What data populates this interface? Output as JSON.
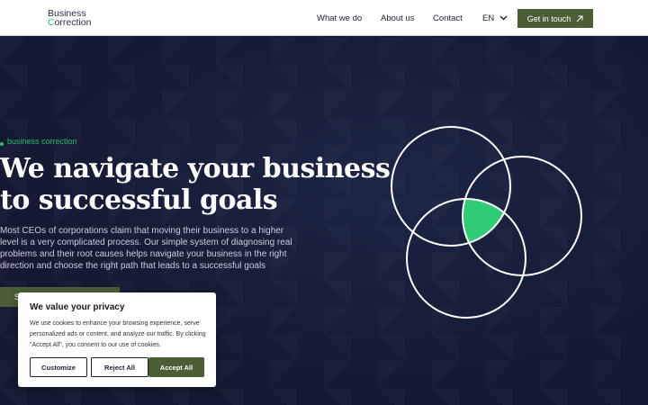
{
  "header": {
    "logo_line1": "Business",
    "logo_line2_rest": "orrection",
    "logo_line2_accent": "C",
    "nav": [
      "What we do",
      "About us",
      "Contact"
    ],
    "language": "EN",
    "cta_label": "Get in touch"
  },
  "hero": {
    "eyebrow": "business correction",
    "title_line1": "We navigate your business",
    "title_line2": "to successful goals",
    "description": "Most CEOs of corporations claim that moving their business to a higher level is a very complicated process. Our simple system of diagnosing real problems and their root causes helps navigate your business in the right direction and choose the right path that leads to a successful goals",
    "button_label": "S"
  },
  "cookie": {
    "title": "We value your privacy",
    "text": "We use cookies to enhance your browsing experience, serve personalized ads or content, and analyze our traffic. By clicking \"Accept All\", you consent to our use of cookies.",
    "customize": "Customize",
    "reject": "Reject All",
    "accept": "Accept All"
  },
  "colors": {
    "accent_green": "#2fbd72",
    "button_olive": "#4c5e35",
    "hero_navy": "#141a33"
  },
  "icons": [
    "arrow-up-right-icon",
    "chevron-down-icon",
    "venn-diagram-icon"
  ]
}
